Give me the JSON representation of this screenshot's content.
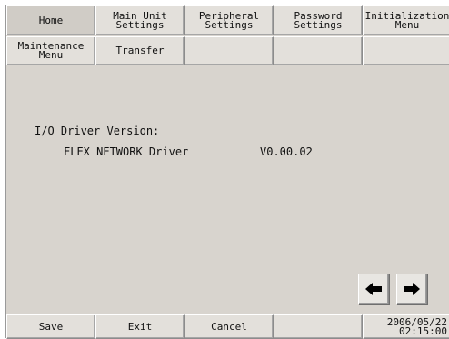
{
  "tabs_row1": [
    {
      "label": "Home"
    },
    {
      "label": "Main Unit\nSettings"
    },
    {
      "label": "Peripheral\nSettings"
    },
    {
      "label": "Password\nSettings"
    },
    {
      "label": "Initialization\nMenu"
    }
  ],
  "tabs_row2": [
    {
      "label": "Maintenance\nMenu"
    },
    {
      "label": "Transfer"
    },
    {
      "label": ""
    },
    {
      "label": ""
    },
    {
      "label": ""
    }
  ],
  "content": {
    "section_label": "I/O Driver Version:",
    "driver_name": "FLEX NETWORK Driver",
    "driver_version": "V0.00.02"
  },
  "navigation": {
    "prev_icon": "arrow-left-icon",
    "next_icon": "arrow-right-icon"
  },
  "footer": {
    "save_label": "Save",
    "exit_label": "Exit",
    "cancel_label": "Cancel",
    "date": "2006/05/22",
    "time": "02:15:00"
  }
}
